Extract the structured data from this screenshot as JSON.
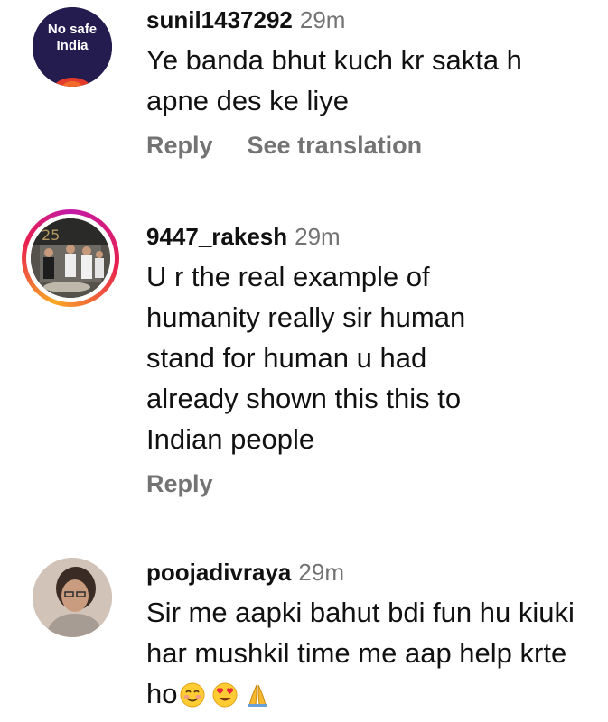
{
  "comments": [
    {
      "username": "sunil1437292",
      "time": "29m",
      "text": "Ye banda  bhut kuch kr sakta h apne des ke liye",
      "reply_label": "Reply",
      "translate_label": "See translation",
      "avatar_text": [
        "No safe",
        "India"
      ],
      "avatar_colors": {
        "bg": "#241b4f",
        "accent": "#e23b2c"
      }
    },
    {
      "username": "9447_rakesh",
      "time": "29m",
      "text": "U r the real example of humanity really sir human stand for human u had already shown this this to Indian people",
      "reply_label": "Reply",
      "avatar_ring": "story-ring",
      "avatar_colors": {
        "ring_start": "#f9a825",
        "ring_mid": "#e8204e",
        "ring_end": "#c21aa8"
      }
    },
    {
      "username": "poojadivraya",
      "time": "29m",
      "text": "Sir me aapki bahut bdi fun hu kiuki har mushkil time me aap help krte ho",
      "emojis": [
        "smiling-face-icon",
        "heart-eyes-icon",
        "folded-hands-icon"
      ]
    }
  ]
}
